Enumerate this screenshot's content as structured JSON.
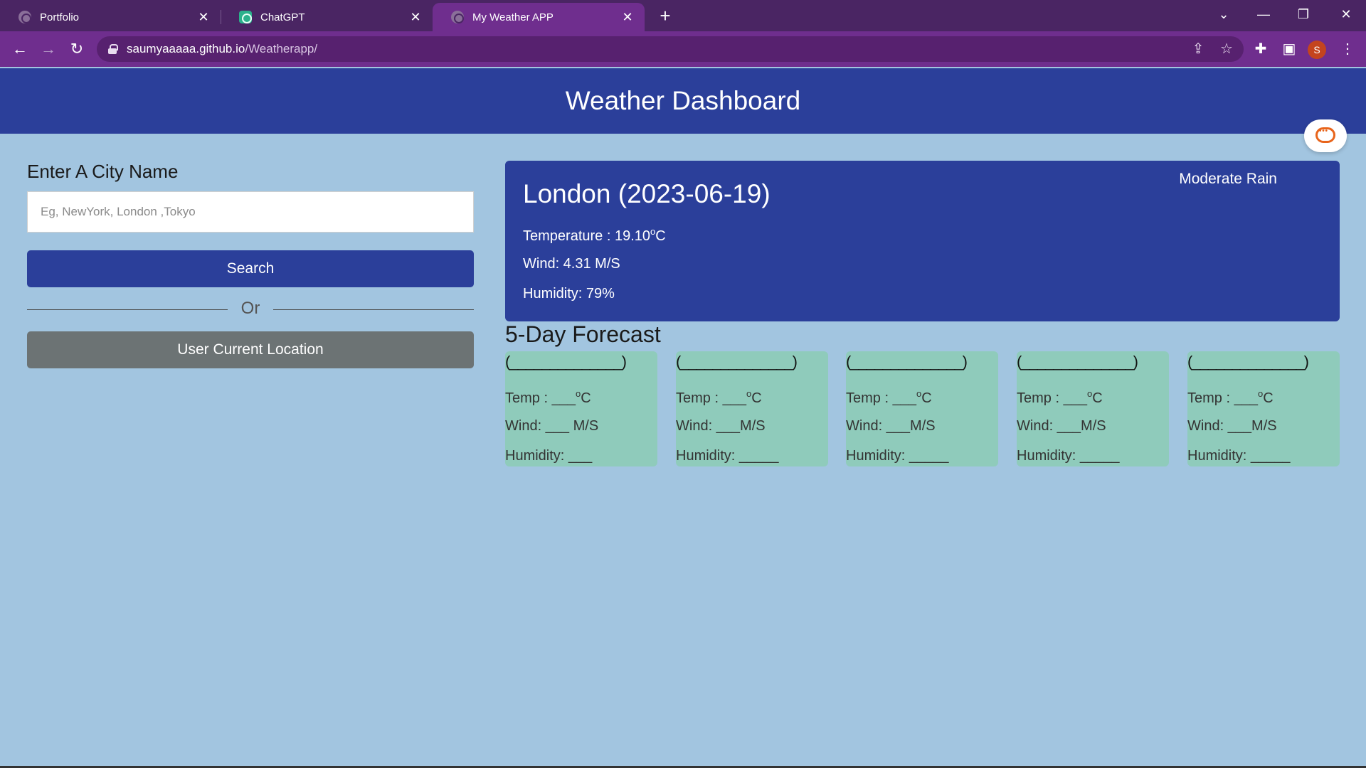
{
  "browser": {
    "tabs": [
      {
        "title": "Portfolio",
        "active": false
      },
      {
        "title": "ChatGPT",
        "active": false
      },
      {
        "title": "My Weather APP",
        "active": true
      }
    ],
    "url_host": "saumyaaaaa.github.io",
    "url_path": "/Weatherapp/",
    "profile_initial": "S",
    "accent_colors": {
      "frame": "#4a2563",
      "toolbar": "#6f2e8e"
    }
  },
  "page": {
    "header_title": "Weather Dashboard",
    "search": {
      "label": "Enter A City Name",
      "placeholder": "Eg, NewYork, London ,Tokyo",
      "value": "",
      "button_label": "Search",
      "or_text": "Or",
      "location_button_label": "User Current Location"
    },
    "current": {
      "title": "London (2023-06-19)",
      "condition": "Moderate Rain",
      "temperature_prefix": "Temperature : 19.10",
      "temperature_sup": "o",
      "temperature_unit": "C",
      "wind": "Wind: 4.31 M/S",
      "humidity": "Humidity: 79%"
    },
    "forecast_title": "5-Day Forecast",
    "forecast": [
      {
        "date": "(______________)",
        "temp_prefix": "Temp : ___",
        "sup": "o",
        "unit": "C",
        "wind": "Wind: ___ M/S",
        "humidity": "Humidity: ___"
      },
      {
        "date": "(______________)",
        "temp_prefix": "Temp : ___",
        "sup": "o",
        "unit": "C",
        "wind": "Wind: ___M/S",
        "humidity": "Humidity: _____"
      },
      {
        "date": "(______________)",
        "temp_prefix": "Temp : ___",
        "sup": "o",
        "unit": "C",
        "wind": "Wind: ___M/S",
        "humidity": "Humidity: _____"
      },
      {
        "date": "(______________)",
        "temp_prefix": "Temp : ___",
        "sup": "o",
        "unit": "C",
        "wind": "Wind: ___M/S",
        "humidity": "Humidity: _____"
      },
      {
        "date": "(______________)",
        "temp_prefix": "Temp : ___",
        "sup": "o",
        "unit": "C",
        "wind": "Wind: ___M/S",
        "humidity": "Humidity: _____"
      }
    ],
    "colors": {
      "header": "#2b3f9a",
      "background": "#a2c5e0",
      "forecast_card": "#8fcbbb",
      "location_button": "#6c7374"
    }
  },
  "icons": {
    "back": "back-arrow-icon",
    "forward": "forward-arrow-icon",
    "reload": "reload-icon",
    "share": "share-icon",
    "bookmark": "star-icon",
    "extensions": "puzzle-icon",
    "side_panel": "side-panel-icon",
    "menu": "kebab-menu-icon",
    "chat": "chat-icon"
  }
}
